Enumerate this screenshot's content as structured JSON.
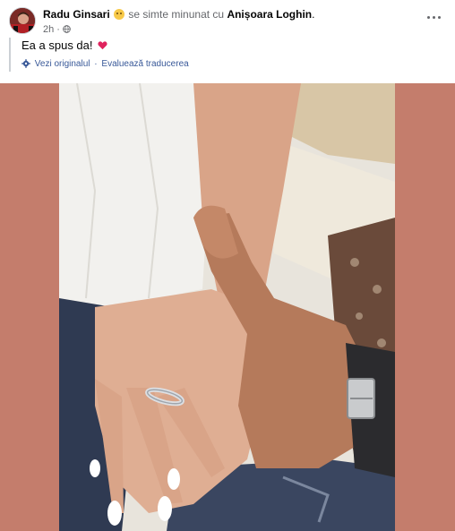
{
  "post": {
    "author": "Radu Ginsari",
    "feeling_text": "se simte minunat cu",
    "tagged": "Anișoara Loghin",
    "trailing_punct": ".",
    "time": "2h",
    "separator": "·",
    "privacy_icon": "globe-icon",
    "caption": "Ea a spus da!",
    "caption_emoji": "heart-icon",
    "translation": {
      "icon": "gear-icon",
      "see_original": "Vezi originalul",
      "sep": "·",
      "rate": "Evaluează traducerea"
    },
    "more_icon": "more-horizontal-icon"
  },
  "colors": {
    "photo_background": "#c47d6c",
    "link": "#385898",
    "meta_text": "#65676b",
    "heart": "#e0245e"
  }
}
